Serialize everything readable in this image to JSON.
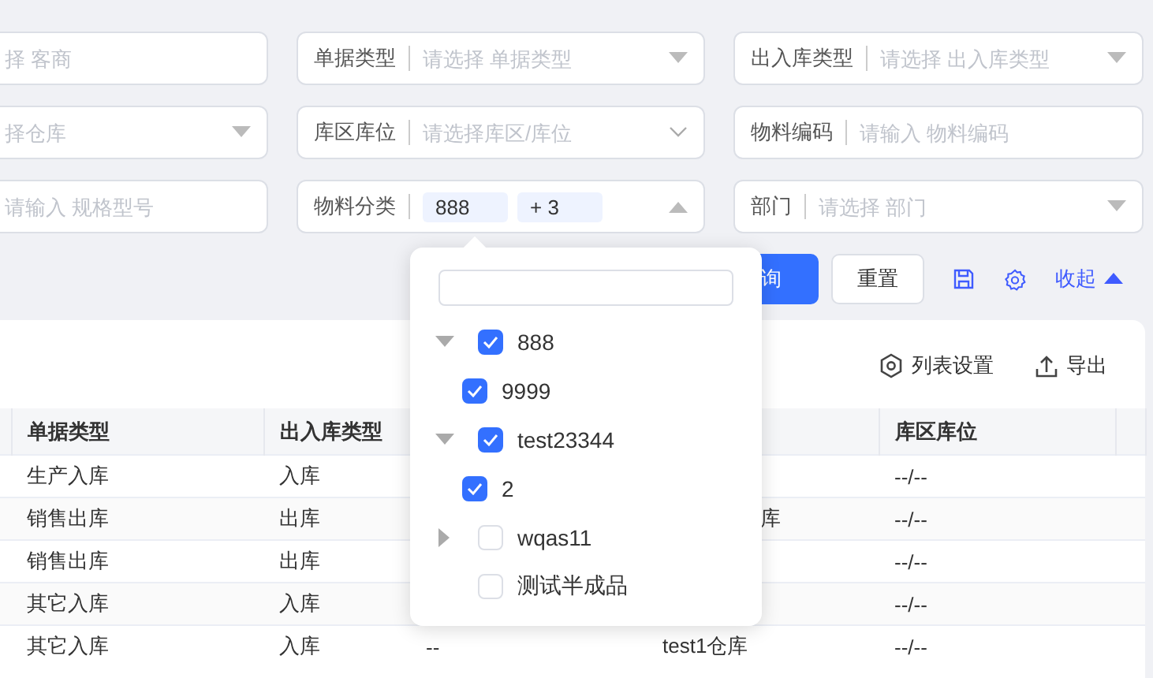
{
  "filters": [
    {
      "kind": "input",
      "placeholder": "择 客商"
    },
    {
      "kind": "select",
      "label": "单据类型",
      "placeholder": "请选择 单据类型"
    },
    {
      "kind": "select",
      "label": "出入库类型",
      "placeholder": "请选择 出入库类型"
    },
    {
      "kind": "select",
      "placeholder": "择仓库"
    },
    {
      "kind": "cascader",
      "label": "库区库位",
      "placeholder": "请选择库区/库位"
    },
    {
      "kind": "input",
      "label": "物料编码",
      "placeholder": "请输入 物料编码"
    },
    {
      "kind": "input",
      "placeholder": "请输入 规格型号"
    },
    {
      "kind": "multi-select",
      "label": "物料分类",
      "open": true,
      "tags": [
        "888",
        "+ 3"
      ]
    },
    {
      "kind": "select",
      "label": "部门",
      "placeholder": "请选择 部门"
    }
  ],
  "actions": {
    "query": "询",
    "reset": "重置",
    "collapse": "收起"
  },
  "toolbar": {
    "column_settings": "列表设置",
    "export": "导出"
  },
  "table": {
    "columns": [
      null,
      "单据类型",
      "出入库类型",
      null,
      null,
      "库区库位",
      null
    ],
    "rows": [
      {
        "cells": [
          null,
          "生产入库",
          "入库",
          null,
          null,
          "--/--",
          null
        ]
      },
      {
        "cells": [
          null,
          "销售出库",
          "出库",
          null,
          {
            "text": "库",
            "clipped": true
          },
          "--/--",
          null
        ]
      },
      {
        "cells": [
          null,
          "销售出库",
          "出库",
          null,
          null,
          "--/--",
          null
        ]
      },
      {
        "cells": [
          null,
          "其它入库",
          "入库",
          null,
          null,
          "--/--",
          null
        ]
      },
      {
        "cells": [
          null,
          "其它入库",
          "入库",
          "--",
          "test1仓库",
          "--/--",
          null
        ]
      }
    ]
  },
  "tree_dropdown": {
    "items": [
      {
        "label": "888",
        "checked": true,
        "expanded": true,
        "children": [
          {
            "label": "9999",
            "checked": true
          }
        ]
      },
      {
        "label": "test23344",
        "checked": true,
        "expanded": true,
        "children": [
          {
            "label": "2",
            "checked": true
          }
        ]
      },
      {
        "label": "wqas11",
        "checked": false,
        "expanded": false
      },
      {
        "label": "测试半成品",
        "checked": false
      }
    ]
  }
}
